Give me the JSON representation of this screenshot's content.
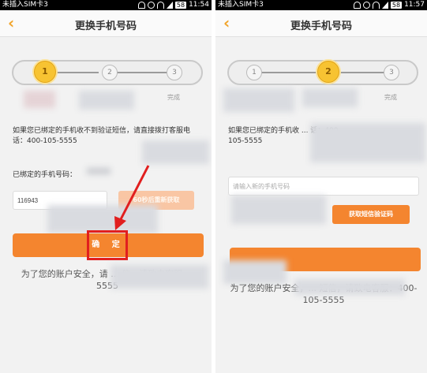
{
  "statusbar": {
    "left": {
      "carrier": "未插入SIM卡3",
      "battery": "58",
      "time": "11:54"
    },
    "right": {
      "carrier": "未插入SIM卡3",
      "battery": "58",
      "time": "11:57"
    }
  },
  "title": "更换手机号码",
  "back_icon": "chevron-left-icon",
  "steps": [
    "1",
    "2",
    "3"
  ],
  "step_done_label": "完成",
  "panel1": {
    "info": "如果您已绑定的手机收不到验证短信，请直接拨打客服电话：400-105-5555",
    "bound_label": "已绑定的手机号码：",
    "code_value": "116943",
    "resend_label": "60秒后重新获取",
    "confirm_label": "确 定",
    "footer": "为了您的账户安全，请 ... 信，请致电客服 ... 5555"
  },
  "panel2": {
    "info": "如果您已绑定的手机收 ... 话：400-105-5555",
    "new_phone_placeholder": "请输入新的手机号码",
    "get_code_label": "获取短信验证码",
    "footer": "为了您的账户安全，... 短信，请致电客服：400-105-5555"
  },
  "colors": {
    "accent": "#f4852f",
    "step_active": "#f7c332",
    "annotation": "#e11f1f"
  }
}
